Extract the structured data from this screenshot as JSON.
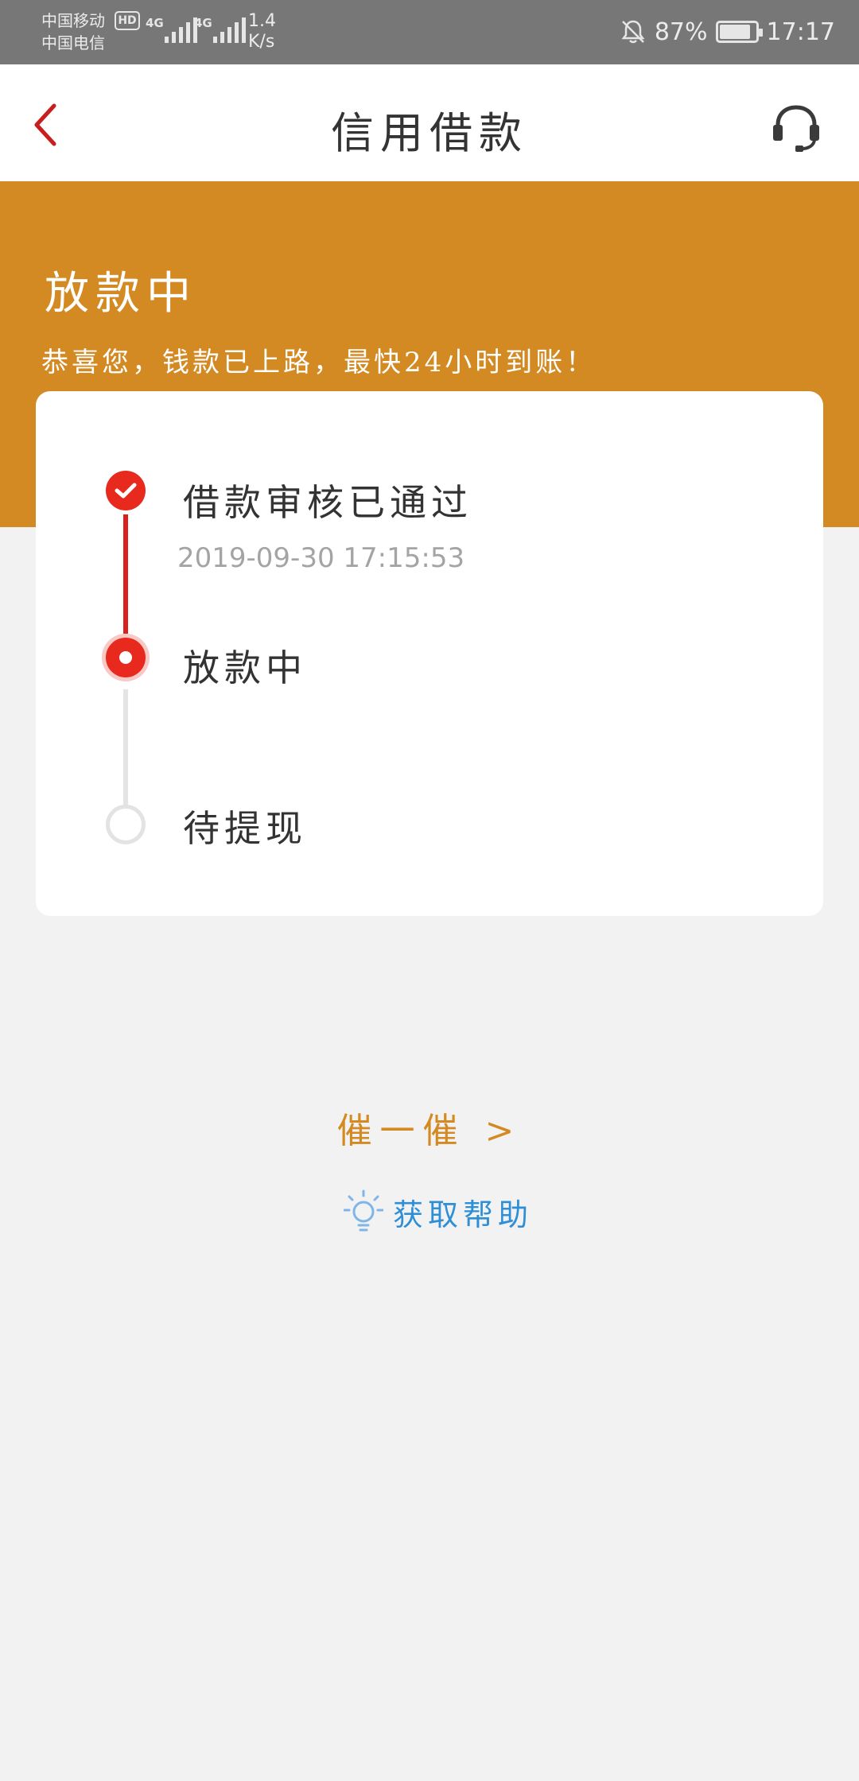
{
  "status_bar": {
    "carrier_1": "中国移动",
    "carrier_2": "中国电信",
    "hd": "HD",
    "network_1": "4G",
    "network_2": "4G",
    "speed_value": "1.4",
    "speed_unit": "K/s",
    "battery": "87%",
    "battery_level": 0.87,
    "time": "17:17"
  },
  "header": {
    "title": "信用借款"
  },
  "banner": {
    "title": "放款中",
    "subtitle": "恭喜您，钱款已上路，最快24小时到账！"
  },
  "steps": [
    {
      "label": "借款审核已通过",
      "time": "2019-09-30 17:15:53",
      "status": "done"
    },
    {
      "label": "放款中",
      "status": "current"
    },
    {
      "label": "待提现",
      "status": "pending"
    }
  ],
  "actions": {
    "urge_label": "催一催 >",
    "help_label": "获取帮助"
  },
  "colors": {
    "accent_orange": "#d38a22",
    "step_red": "#e8291d",
    "help_blue": "#2f8fd6",
    "status_bar_gray": "#777777"
  }
}
